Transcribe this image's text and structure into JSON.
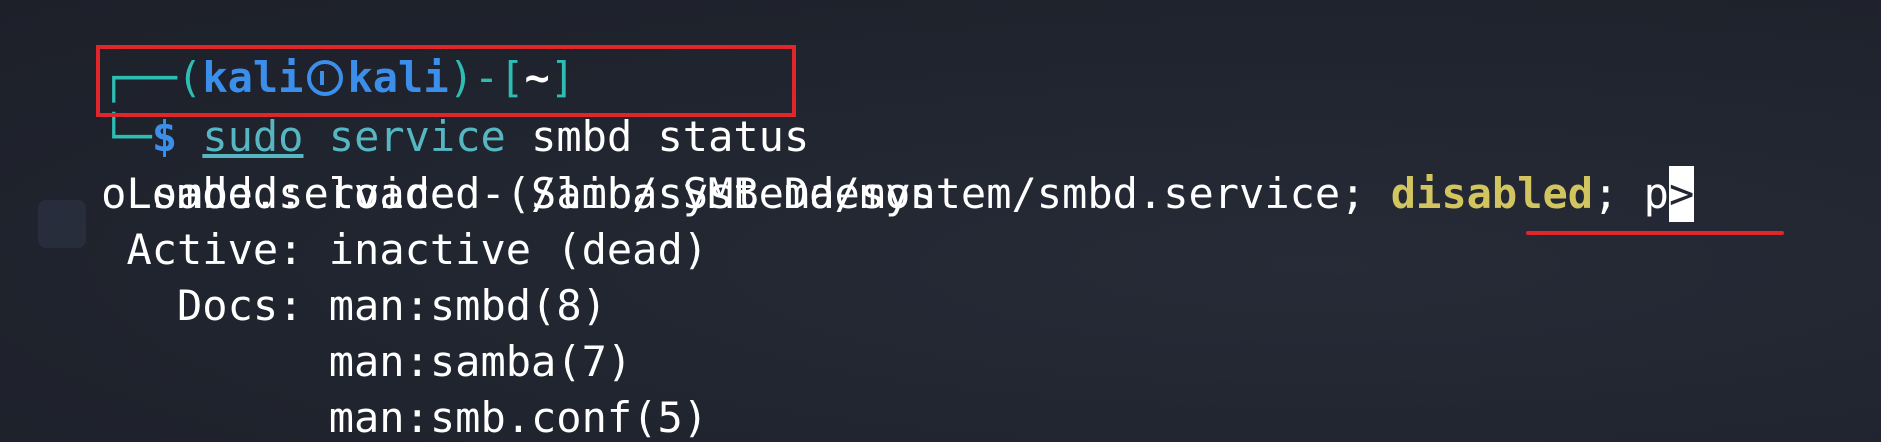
{
  "prompt": {
    "open_bracket": "(",
    "user": "kali",
    "host": "kali",
    "close_bracket": ")",
    "dash": "-",
    "dir_open": "[",
    "dir": "~",
    "dir_close": "]",
    "symbol": "$"
  },
  "command": {
    "sudo": "sudo",
    "service": "service",
    "args": "smbd status"
  },
  "output": {
    "title_bullet": "o",
    "title": "smbd.service - Samba SMB Daemon",
    "loaded_label": "Loaded:",
    "loaded_prefix": "loaded (/lib/systemd/system/smbd.service;",
    "loaded_state": "disabled",
    "loaded_suffix": "; p",
    "truncate_marker": ">",
    "active_label": "Active:",
    "active_value": "inactive (dead)",
    "docs_label": "Docs:",
    "docs": [
      "man:smbd(8)",
      "man:samba(7)",
      "man:smb.conf(5)"
    ]
  },
  "colors": {
    "background": "#222733",
    "prompt_frame": "#2ebdb3",
    "prompt_user": "#3b8eea",
    "command": "#56b6c2",
    "disabled": "#d2c55f",
    "annotation": "#e0262b"
  }
}
